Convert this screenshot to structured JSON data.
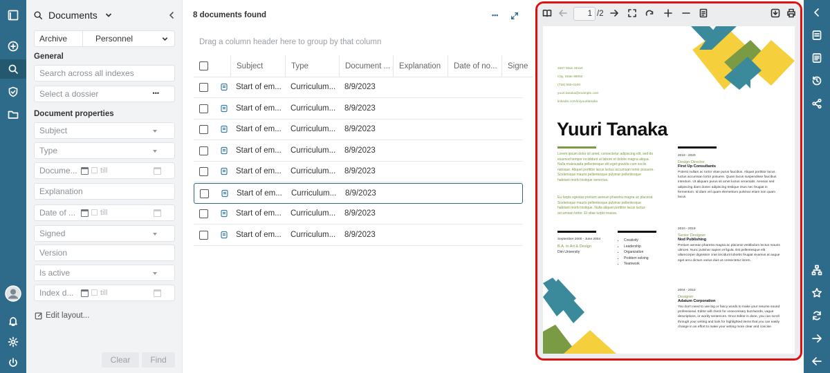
{
  "filter_panel": {
    "title": "Documents",
    "archive_label": "Archive",
    "archive_value": "Personnel",
    "general_heading": "General",
    "search_placeholder": "Search across all indexes",
    "dossier_placeholder": "Select a dossier",
    "dossier_more": "•••",
    "props_heading": "Document properties",
    "subject": "Subject",
    "type": "Type",
    "doc_date": "Docume...",
    "till": "till",
    "explanation": "Explanation",
    "date_of": "Date of ...",
    "signed": "Signed",
    "version": "Version",
    "is_active": "Is active",
    "index_date": "Index d...",
    "edit_layout": "Edit layout...",
    "clear": "Clear",
    "find": "Find"
  },
  "list": {
    "found": "8 documents found",
    "more": "•••",
    "group_hint": "Drag a column header here to group by that column",
    "columns": [
      "Subject",
      "Type",
      "Document ...",
      "Explanation",
      "Date of no...",
      "Signe"
    ],
    "rows": [
      {
        "subject": "Start of em...",
        "type": "Curriculum...",
        "date": "8/9/2023"
      },
      {
        "subject": "Start of em...",
        "type": "Curriculum...",
        "date": "8/9/2023"
      },
      {
        "subject": "Start of em...",
        "type": "Curriculum...",
        "date": "8/9/2023"
      },
      {
        "subject": "Start of em...",
        "type": "Curriculum...",
        "date": "8/9/2023"
      },
      {
        "subject": "Start of em...",
        "type": "Curriculum...",
        "date": "8/9/2023"
      },
      {
        "subject": "Start of em...",
        "type": "Curriculum...",
        "date": "8/9/2023"
      },
      {
        "subject": "Start of em...",
        "type": "Curriculum...",
        "date": "8/9/2023"
      },
      {
        "subject": "Start of em...",
        "type": "Curriculum...",
        "date": "8/9/2023"
      }
    ]
  },
  "viewer": {
    "page_current": "1",
    "page_total": "/2",
    "resume": {
      "contact": [
        "4567 Main Street",
        "City, State 98052",
        "(718) 555-0100",
        "yuuri.tanaka@example.com",
        "linkedin.com/in/yuuritanaka"
      ],
      "name": "Yuuri Tanaka",
      "summary1": "Lorem ipsum dolor sit amet, consectetur adipiscing elit, sed do eiusmod tempor incididunt ut labore et dolore magna aliqua. Nulla malesuada pellentesque elit eget gravida cum sociis natoque. Aliquet porttitor lacus luctus accumsan tortor posuere. Scelerisque mauris pellentesque pulvinar pellentesque habitant morbi tristique senectus.",
      "summary2": "Eu turpis egestas pretium aenean pharetra magna ac placerat. Scelerisque mauris pellentesque pulvinar pellentesque habitant morbi tristique. Nulla aliquet porttitor lacus luctus accumsan tortor. Et vitae turpis massa.",
      "edu_dates": "September 2000 - June 2004",
      "edu_degree": "B.A. in Art & Design",
      "edu_school": "Dim University",
      "skills": [
        "Creativity",
        "Leadership",
        "Organization",
        "Problem solving",
        "Teamwork"
      ],
      "jobs": [
        {
          "dates": "2019 - 2020",
          "title": "Design Director",
          "company": "First Up Consultants",
          "desc": "Potenti nullam ac tortor vitae purus faucibus. Aliquet porttitor lacus luctus accumsan tortor posuere. Quam lacus suspendisse faucibus interdum. Ut aliquam purus sit amet luctus venenatis. Aenean sed adipiscing diam donec adipiscing tristique risus nec feugiat in fermentum. Id diam vel quam elementum pulvinar etiam non quam lacus."
        },
        {
          "dates": "2010 - 2019",
          "title": "Senior Designer",
          "company": "Nod Publishing",
          "desc": "Pretium aenean pharetra magna ac placerat vestibulum lectus mauris ultrices. Nunc pulvinar sapien et ligula. Est pellentesque elit ullamcorper dignissim cras tincidunt lobortis feugiat vivamus at augue eget arcu dictum varius duis at consectetur lorem."
        },
        {
          "dates": "2004 - 2010",
          "title": "Designer",
          "company": "Adatum Corporation",
          "desc": "You don't need to use big or fancy words to make your resume sound professional. Editor will check for unnecessary buzzwords, vague descriptions, or wordy sentences. Once Editor is done, you can scroll through your writing and look for highlighted items that you can easily change in an effort to make your writing more clear and concise."
        }
      ]
    }
  },
  "colors": {
    "rail": "#2e6a8a",
    "accent_teal": "#3a8a9c",
    "accent_yellow": "#f5cf3c",
    "accent_green": "#7a9a44",
    "highlight": "#e01010"
  }
}
